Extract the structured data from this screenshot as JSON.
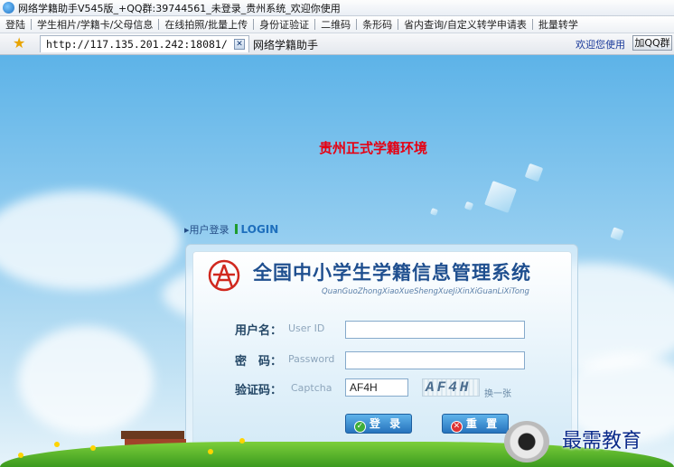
{
  "window": {
    "title": "网络学籍助手V545版_+QQ群:39744561_未登录_贵州系统_欢迎你使用"
  },
  "menu": [
    "登陆",
    "学生相片/学籍卡/父母信息",
    "在线拍照/批量上传",
    "身份证验证",
    "二维码",
    "条形码",
    "省内查询/自定义转学申请表",
    "批量转学"
  ],
  "tabs": {
    "url": "http://117.135.201.242:18081/",
    "second_tab": "网络学籍助手",
    "right_link": "欢迎您使用",
    "qq_button": "加QQ群"
  },
  "page": {
    "environment_title": "贵州正式学籍环境",
    "login_header": "用户登录",
    "login_header_en": "LOGIN",
    "system_title": "全国中小学生学籍信息管理系统",
    "system_pinyin": "QuanGuoZhongXiaoXueShengXueJiXinXiGuanLiXiTong",
    "fields": {
      "user_label": "用户名：",
      "user_hint": "User ID",
      "user_value": "",
      "pwd_label": "密　码：",
      "pwd_hint": "Password",
      "pwd_value": "",
      "captcha_label": "验证码：",
      "captcha_hint": "Captcha",
      "captcha_value": "AF4H",
      "captcha_image_text": "AF4H",
      "refresh_text": "换一张"
    },
    "buttons": {
      "login": "登 录",
      "reset": "重 置"
    },
    "watermark": "最需教育"
  }
}
